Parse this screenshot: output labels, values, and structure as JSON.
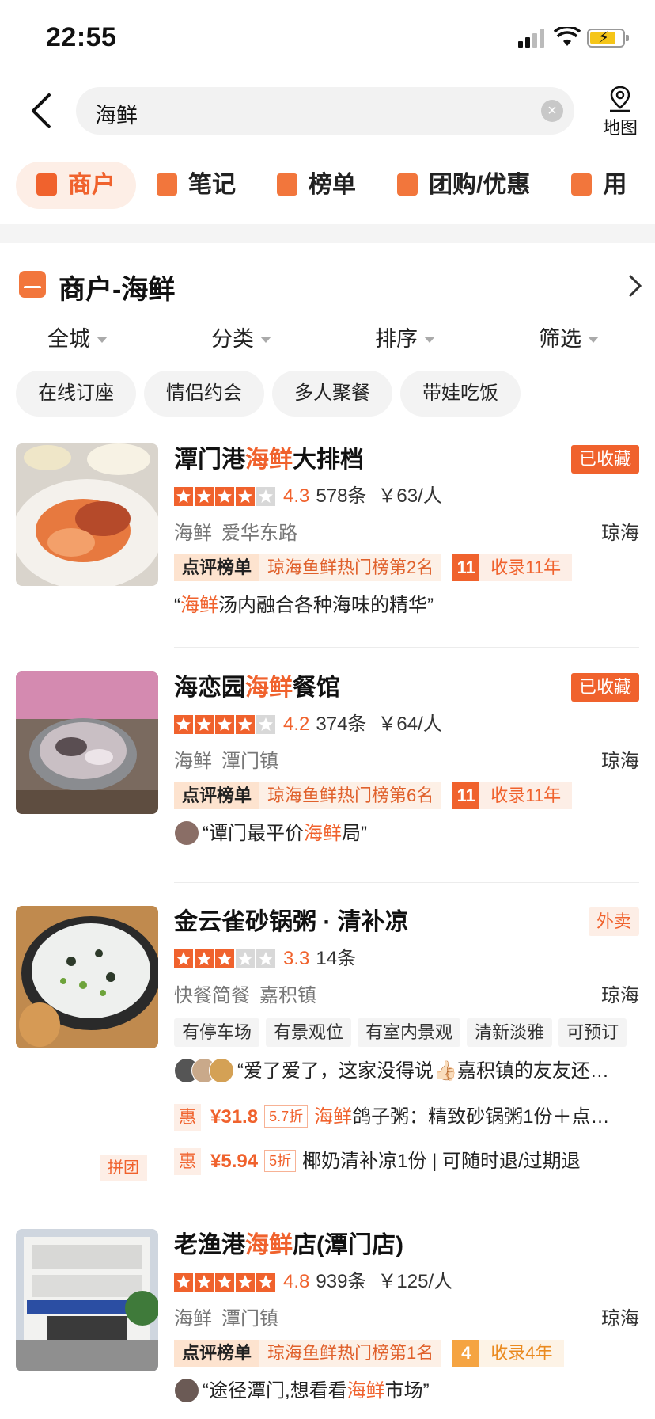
{
  "status": {
    "time": "22:55"
  },
  "search": {
    "query": "海鲜",
    "map_label": "地图"
  },
  "tabs": [
    {
      "label": "商户"
    },
    {
      "label": "笔记"
    },
    {
      "label": "榜单"
    },
    {
      "label": "团购/优惠"
    },
    {
      "label": "用"
    }
  ],
  "section": {
    "title": "商户-海鲜"
  },
  "filters": [
    {
      "label": "全城"
    },
    {
      "label": "分类"
    },
    {
      "label": "排序"
    },
    {
      "label": "筛选"
    }
  ],
  "chips": [
    {
      "label": "在线订座"
    },
    {
      "label": "情侣约会"
    },
    {
      "label": "多人聚餐"
    },
    {
      "label": "带娃吃饭"
    }
  ],
  "colors": {
    "accent": "#f0622d",
    "gold": "#f5a442"
  },
  "shops": [
    {
      "name_pre": "潭门港",
      "name_hl": "海鲜",
      "name_post": "大排档",
      "badge": "已收藏",
      "stars": 4,
      "score": "4.3",
      "reviews": "578条",
      "price": "￥63/人",
      "category": "海鲜",
      "area": "爱华东路",
      "region": "琼海",
      "rank_tag": "点评榜单",
      "rank_text": "琼海鱼鲜热门榜第2名",
      "years_num": "11",
      "years_text": "收录11年",
      "quote_pre": "“",
      "quote_hl": "海鲜",
      "quote_post": "汤内融合各种海味的精华”"
    },
    {
      "name_pre": "海恋园",
      "name_hl": "海鲜",
      "name_post": "餐馆",
      "badge": "已收藏",
      "stars": 4,
      "score": "4.2",
      "reviews": "374条",
      "price": "￥64/人",
      "category": "海鲜",
      "area": "潭门镇",
      "region": "琼海",
      "rank_tag": "点评榜单",
      "rank_text": "琼海鱼鲜热门榜第6名",
      "years_num": "11",
      "years_text": "收录11年",
      "quote_pre": "“谭门最平价",
      "quote_hl": "海鲜",
      "quote_post": "局”"
    },
    {
      "name_pre": "金云雀砂锅粥 · 清补凉",
      "name_hl": "",
      "name_post": "",
      "badge": "外卖",
      "stars": 3,
      "score": "3.3",
      "reviews": "14条",
      "price": "",
      "category": "快餐简餐",
      "area": "嘉积镇",
      "region": "琼海",
      "tags": [
        "有停车场",
        "有景观位",
        "有室内景观",
        "清新淡雅",
        "可预订"
      ],
      "quote": "“爱了爱了，这家没得说👍🏻嘉积镇的友友还…",
      "deals": [
        {
          "hui": "惠",
          "price": "¥31.8",
          "discount": "5.7折",
          "text_hl": "海鲜",
          "text": "鸽子粥：精致砂锅粥1份＋点…"
        },
        {
          "hui": "惠",
          "price": "¥5.94",
          "discount": "5折",
          "text_hl": "",
          "text": "椰奶清补凉1份 | 可随时退/过期退"
        }
      ],
      "pintuan": "拼团"
    },
    {
      "name_pre": "老渔港",
      "name_hl": "海鲜",
      "name_post": "店(潭门店)",
      "badge": "",
      "stars": 5,
      "score": "4.8",
      "reviews": "939条",
      "price": "￥125/人",
      "category": "海鲜",
      "area": "潭门镇",
      "region": "琼海",
      "rank_tag": "点评榜单",
      "rank_text": "琼海鱼鲜热门榜第1名",
      "years_num": "4",
      "years_text": "收录4年",
      "quote_pre": "“途径潭门,想看看",
      "quote_hl": "海鲜",
      "quote_post": "市场”"
    }
  ]
}
